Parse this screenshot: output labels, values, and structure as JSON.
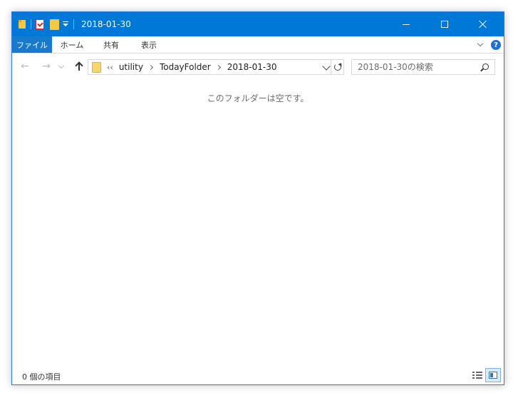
{
  "window": {
    "title": "2018-01-30"
  },
  "ribbon": {
    "tabs": [
      {
        "label": "ファイル",
        "active": true
      },
      {
        "label": "ホーム",
        "active": false
      },
      {
        "label": "共有",
        "active": false
      },
      {
        "label": "表示",
        "active": false
      }
    ],
    "help_label": "?"
  },
  "address": {
    "overflow": "‹‹",
    "breadcrumbs": [
      "utility",
      "TodayFolder",
      "2018-01-30"
    ]
  },
  "search": {
    "placeholder": "2018-01-30の検索"
  },
  "content": {
    "empty_message": "このフォルダーは空です。"
  },
  "status": {
    "item_count": "0 個の項目"
  },
  "colors": {
    "titlebar": "#0078d7",
    "file_tab": "#1979ca",
    "folder": "#f5c842"
  }
}
